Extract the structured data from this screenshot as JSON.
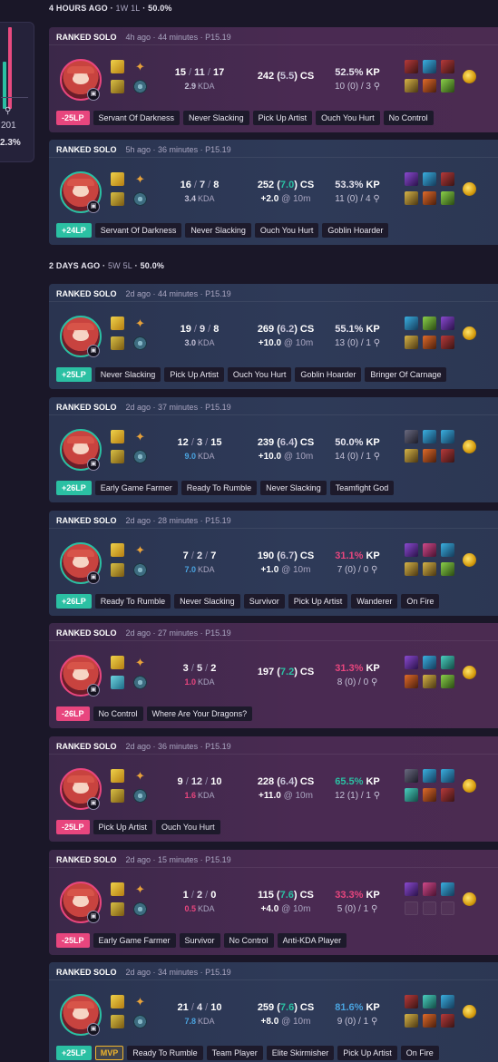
{
  "summary_panel": {
    "count": "201",
    "percent": "2.3%",
    "icon": "ward-icon"
  },
  "groups": [
    {
      "header": {
        "time": "4 HOURS AGO",
        "record": "1W 1L",
        "winrate": "50.0%"
      },
      "games": [
        {
          "result": "loss",
          "mode": "RANKED SOLO",
          "ago": "4h ago",
          "duration": "44 minutes",
          "patch": "P15.19",
          "kills": "15",
          "deaths": "11",
          "assists": "17",
          "kda": "2.9",
          "kda_label": "KDA",
          "kda_tone": "gray",
          "cs_line_a": "242 (",
          "cs_per_min": "5.5",
          "cs_line_b": ") CS",
          "cs_per_min_tone": "gray",
          "gold_diff": "",
          "gold_at": "",
          "kp_value": "52.5%",
          "kp_label": "KP",
          "kp_tone": "white",
          "vision": "10 (0) / 3 ⚲",
          "lp": "-25LP",
          "mvp": "",
          "tags": [
            "Servant Of Darkness",
            "Never Slacking",
            "Pick Up Artist",
            "Ouch You Hurt",
            "No Control"
          ],
          "items": [
            "i-red",
            "i-blue",
            "i-red",
            "i-gold",
            "i-orange",
            "i-green"
          ]
        },
        {
          "result": "win",
          "mode": "RANKED SOLO",
          "ago": "5h ago",
          "duration": "36 minutes",
          "patch": "P15.19",
          "kills": "16",
          "deaths": "7",
          "assists": "8",
          "kda": "3.4",
          "kda_label": "KDA",
          "kda_tone": "gray",
          "cs_line_a": "252 (",
          "cs_per_min": "7.0",
          "cs_line_b": ") CS",
          "cs_per_min_tone": "good",
          "gold_diff": "+2.0",
          "gold_at": "@ 10m",
          "kp_value": "53.3%",
          "kp_label": "KP",
          "kp_tone": "white",
          "vision": "11 (0) / 4 ⚲",
          "lp": "+24LP",
          "mvp": "",
          "tags": [
            "Servant Of Darkness",
            "Never Slacking",
            "Ouch You Hurt",
            "Goblin Hoarder"
          ],
          "items": [
            "i-purple",
            "i-blue",
            "i-red",
            "i-gold",
            "i-orange",
            "i-green"
          ]
        }
      ]
    },
    {
      "header": {
        "time": "2 DAYS AGO",
        "record": "5W 5L",
        "winrate": "50.0%"
      },
      "games": [
        {
          "result": "win",
          "mode": "RANKED SOLO",
          "ago": "2d ago",
          "duration": "44 minutes",
          "patch": "P15.19",
          "kills": "19",
          "deaths": "9",
          "assists": "8",
          "kda": "3.0",
          "kda_label": "KDA",
          "kda_tone": "gray",
          "cs_line_a": "269 (",
          "cs_per_min": "6.2",
          "cs_line_b": ") CS",
          "cs_per_min_tone": "gray",
          "gold_diff": "+10.0",
          "gold_at": "@ 10m",
          "kp_value": "55.1%",
          "kp_label": "KP",
          "kp_tone": "white",
          "vision": "13 (0) / 1 ⚲",
          "lp": "+25LP",
          "mvp": "",
          "tags": [
            "Never Slacking",
            "Pick Up Artist",
            "Ouch You Hurt",
            "Goblin Hoarder",
            "Bringer Of Carnage"
          ],
          "items": [
            "i-blue",
            "i-green",
            "i-purple",
            "i-gold",
            "i-orange",
            "i-red"
          ]
        },
        {
          "result": "win",
          "mode": "RANKED SOLO",
          "ago": "2d ago",
          "duration": "37 minutes",
          "patch": "P15.19",
          "kills": "12",
          "deaths": "3",
          "assists": "15",
          "kda": "9.0",
          "kda_label": "KDA",
          "kda_tone": "blue",
          "cs_line_a": "239 (",
          "cs_per_min": "6.4",
          "cs_line_b": ") CS",
          "cs_per_min_tone": "gray",
          "gold_diff": "+10.0",
          "gold_at": "@ 10m",
          "kp_value": "50.0%",
          "kp_label": "KP",
          "kp_tone": "white",
          "vision": "14 (0) / 1 ⚲",
          "lp": "+26LP",
          "mvp": "",
          "tags": [
            "Early Game Farmer",
            "Ready To Rumble",
            "Never Slacking",
            "Teamfight God"
          ],
          "items": [
            "i-dark",
            "i-blue",
            "i-blue",
            "i-gold",
            "i-orange",
            "i-red"
          ]
        },
        {
          "result": "win",
          "mode": "RANKED SOLO",
          "ago": "2d ago",
          "duration": "28 minutes",
          "patch": "P15.19",
          "kills": "7",
          "deaths": "2",
          "assists": "7",
          "kda": "7.0",
          "kda_label": "KDA",
          "kda_tone": "blue",
          "cs_line_a": "190 (",
          "cs_per_min": "6.7",
          "cs_line_b": ") CS",
          "cs_per_min_tone": "gray",
          "gold_diff": "+1.0",
          "gold_at": "@ 10m",
          "kp_value": "31.1%",
          "kp_label": "KP",
          "kp_tone": "neg",
          "vision": "7 (0) / 0 ⚲",
          "lp": "+26LP",
          "mvp": "",
          "tags": [
            "Ready To Rumble",
            "Never Slacking",
            "Survivor",
            "Pick Up Artist",
            "Wanderer",
            "On Fire"
          ],
          "items": [
            "i-purple",
            "i-pink",
            "i-blue",
            "i-gold",
            "i-gold",
            "i-green"
          ]
        },
        {
          "result": "loss",
          "mode": "RANKED SOLO",
          "ago": "2d ago",
          "duration": "27 minutes",
          "patch": "P15.19",
          "kills": "3",
          "deaths": "5",
          "assists": "2",
          "kda": "1.0",
          "kda_label": "KDA",
          "kda_tone": "neg",
          "cs_line_a": "197 (",
          "cs_per_min": "7.2",
          "cs_line_b": ") CS",
          "cs_per_min_tone": "good",
          "gold_diff": "",
          "gold_at": "",
          "kp_value": "31.3%",
          "kp_label": "KP",
          "kp_tone": "neg",
          "vision": "8 (0) / 0 ⚲",
          "lp": "-26LP",
          "mvp": "",
          "tags": [
            "No Control",
            "Where Are Your Dragons?"
          ],
          "items": [
            "i-purple",
            "i-blue",
            "i-teal",
            "i-orange",
            "i-gold",
            "i-green"
          ]
        },
        {
          "result": "loss",
          "mode": "RANKED SOLO",
          "ago": "2d ago",
          "duration": "36 minutes",
          "patch": "P15.19",
          "kills": "9",
          "deaths": "12",
          "assists": "10",
          "kda": "1.6",
          "kda_label": "KDA",
          "kda_tone": "neg",
          "cs_line_a": "228 (",
          "cs_per_min": "6.4",
          "cs_line_b": ") CS",
          "cs_per_min_tone": "gray",
          "gold_diff": "+11.0",
          "gold_at": "@ 10m",
          "kp_value": "65.5%",
          "kp_label": "KP",
          "kp_tone": "good",
          "vision": "12 (1) / 1 ⚲",
          "lp": "-25LP",
          "mvp": "",
          "tags": [
            "Pick Up Artist",
            "Ouch You Hurt"
          ],
          "items": [
            "i-dark",
            "i-blue",
            "i-blue",
            "i-teal",
            "i-orange",
            "i-red"
          ]
        },
        {
          "result": "loss",
          "mode": "RANKED SOLO",
          "ago": "2d ago",
          "duration": "15 minutes",
          "patch": "P15.19",
          "kills": "1",
          "deaths": "2",
          "assists": "0",
          "kda": "0.5",
          "kda_label": "KDA",
          "kda_tone": "neg",
          "cs_line_a": "115 (",
          "cs_per_min": "7.6",
          "cs_line_b": ") CS",
          "cs_per_min_tone": "good",
          "gold_diff": "+4.0",
          "gold_at": "@ 10m",
          "kp_value": "33.3%",
          "kp_label": "KP",
          "kp_tone": "neg",
          "vision": "5 (0) / 1 ⚲",
          "lp": "-25LP",
          "mvp": "",
          "tags": [
            "Early Game Farmer",
            "Survivor",
            "No Control",
            "Anti-KDA Player"
          ],
          "items": [
            "i-purple",
            "i-pink",
            "i-blue",
            "empty",
            "empty",
            "empty"
          ]
        },
        {
          "result": "win",
          "mode": "RANKED SOLO",
          "ago": "2d ago",
          "duration": "34 minutes",
          "patch": "P15.19",
          "kills": "21",
          "deaths": "4",
          "assists": "10",
          "kda": "7.8",
          "kda_label": "KDA",
          "kda_tone": "blue",
          "cs_line_a": "259 (",
          "cs_per_min": "7.6",
          "cs_line_b": ") CS",
          "cs_per_min_tone": "good",
          "gold_diff": "+8.0",
          "gold_at": "@ 10m",
          "kp_value": "81.6%",
          "kp_label": "KP",
          "kp_tone": "blue",
          "vision": "9 (0) / 1 ⚲",
          "lp": "+25LP",
          "mvp": "MVP",
          "tags": [
            "Ready To Rumble",
            "Team Player",
            "Elite Skirmisher",
            "Pick Up Artist",
            "On Fire"
          ],
          "items": [
            "i-red",
            "i-teal",
            "i-blue",
            "i-gold",
            "i-orange",
            "i-red"
          ]
        }
      ]
    }
  ]
}
